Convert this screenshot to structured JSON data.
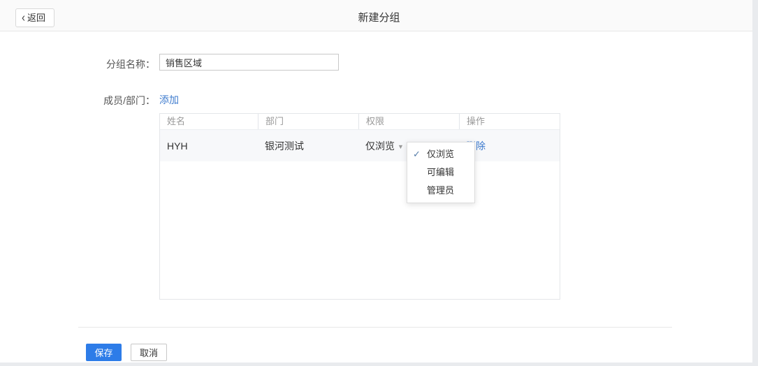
{
  "header": {
    "back_label": "返回",
    "title": "新建分组"
  },
  "icons": {
    "chevron_left": "‹",
    "caret_down": "▼",
    "check": "✓"
  },
  "form": {
    "group_name": {
      "label": "分组名称：",
      "value": "销售区域"
    },
    "members": {
      "label": "成员/部门：",
      "add_label": "添加"
    }
  },
  "table": {
    "columns": [
      "姓名",
      "部门",
      "权限",
      "操作"
    ],
    "rows": [
      {
        "name": "HYH",
        "department": "银河测试",
        "permission": "仅浏览",
        "action": "删除"
      }
    ]
  },
  "dropdown": {
    "options": [
      {
        "label": "仅浏览",
        "selected": true
      },
      {
        "label": "可编辑",
        "selected": false
      },
      {
        "label": "管理员",
        "selected": false
      }
    ]
  },
  "footer": {
    "save_label": "保存",
    "cancel_label": "取消"
  },
  "colors": {
    "primary": "#2d7ce8",
    "link": "#3e7bce",
    "check": "#557ca8",
    "topbar_bg": "#fafafa",
    "row_bg": "#f7f8fa"
  }
}
